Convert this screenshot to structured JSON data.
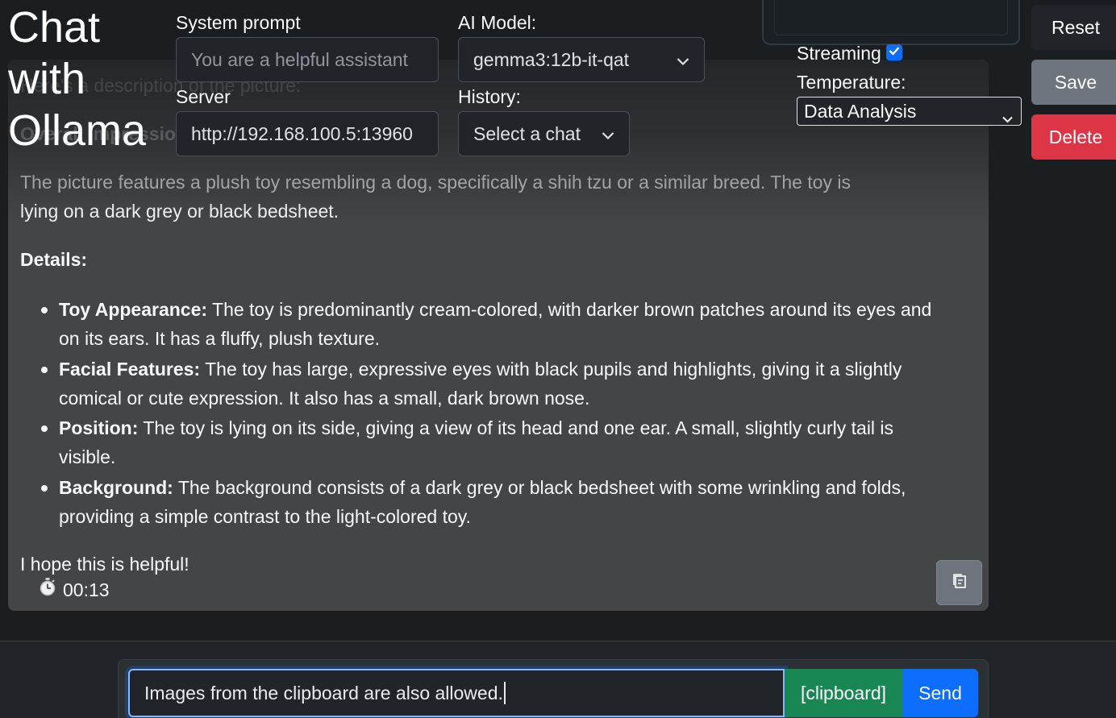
{
  "header": {
    "title": "Chat with Ollama",
    "system_prompt_label": "System prompt",
    "system_prompt_placeholder": "You are a helpful assistant",
    "server_label": "Server",
    "server_value": "http://192.168.100.5:13960",
    "model_label": "AI Model:",
    "model_value": "gemma3:12b-it-qat",
    "history_label": "History:",
    "history_value": "Select a chat",
    "streaming_label": "Streaming",
    "streaming_checked": true,
    "temperature_label": "Temperature:",
    "temperature_value": "Data Analysis",
    "reset_label": "Reset",
    "save_label": "Save",
    "delete_label": "Delete"
  },
  "message": {
    "intro": "Here's a description of the picture:",
    "overall_heading": "Overall Impression:",
    "overall_text_1": "The picture features a plush toy resembling a dog, specifically a shih tzu or a similar breed. The toy is",
    "overall_text_2": "lying on a dark grey or black bedsheet.",
    "details_heading": "Details:",
    "details": [
      {
        "title": "Toy Appearance:",
        "text": " The toy is predominantly cream-colored, with darker brown patches around its eyes and on its ears. It has a fluffy, plush texture."
      },
      {
        "title": "Facial Features:",
        "text": " The toy has large, expressive eyes with black pupils and highlights, giving it a slightly comical or cute expression. It also has a small, dark brown nose."
      },
      {
        "title": "Position:",
        "text": " The toy is lying on its side, giving a view of its head and one ear. A small, slightly curly tail is visible."
      },
      {
        "title": "Background:",
        "text": " The background consists of a dark grey or black bedsheet with some wrinkling and folds, providing a simple contrast to the light-colored toy."
      }
    ],
    "closing": "I hope this is helpful!",
    "timer": "00:13"
  },
  "composer": {
    "input_value": "Images from the clipboard are also allowed.",
    "clipboard_label": "[clipboard]",
    "send_label": "Send"
  },
  "colors": {
    "primary": "#0d6efd",
    "success": "#198754",
    "danger": "#dc3545",
    "secondary": "#6c757d"
  }
}
